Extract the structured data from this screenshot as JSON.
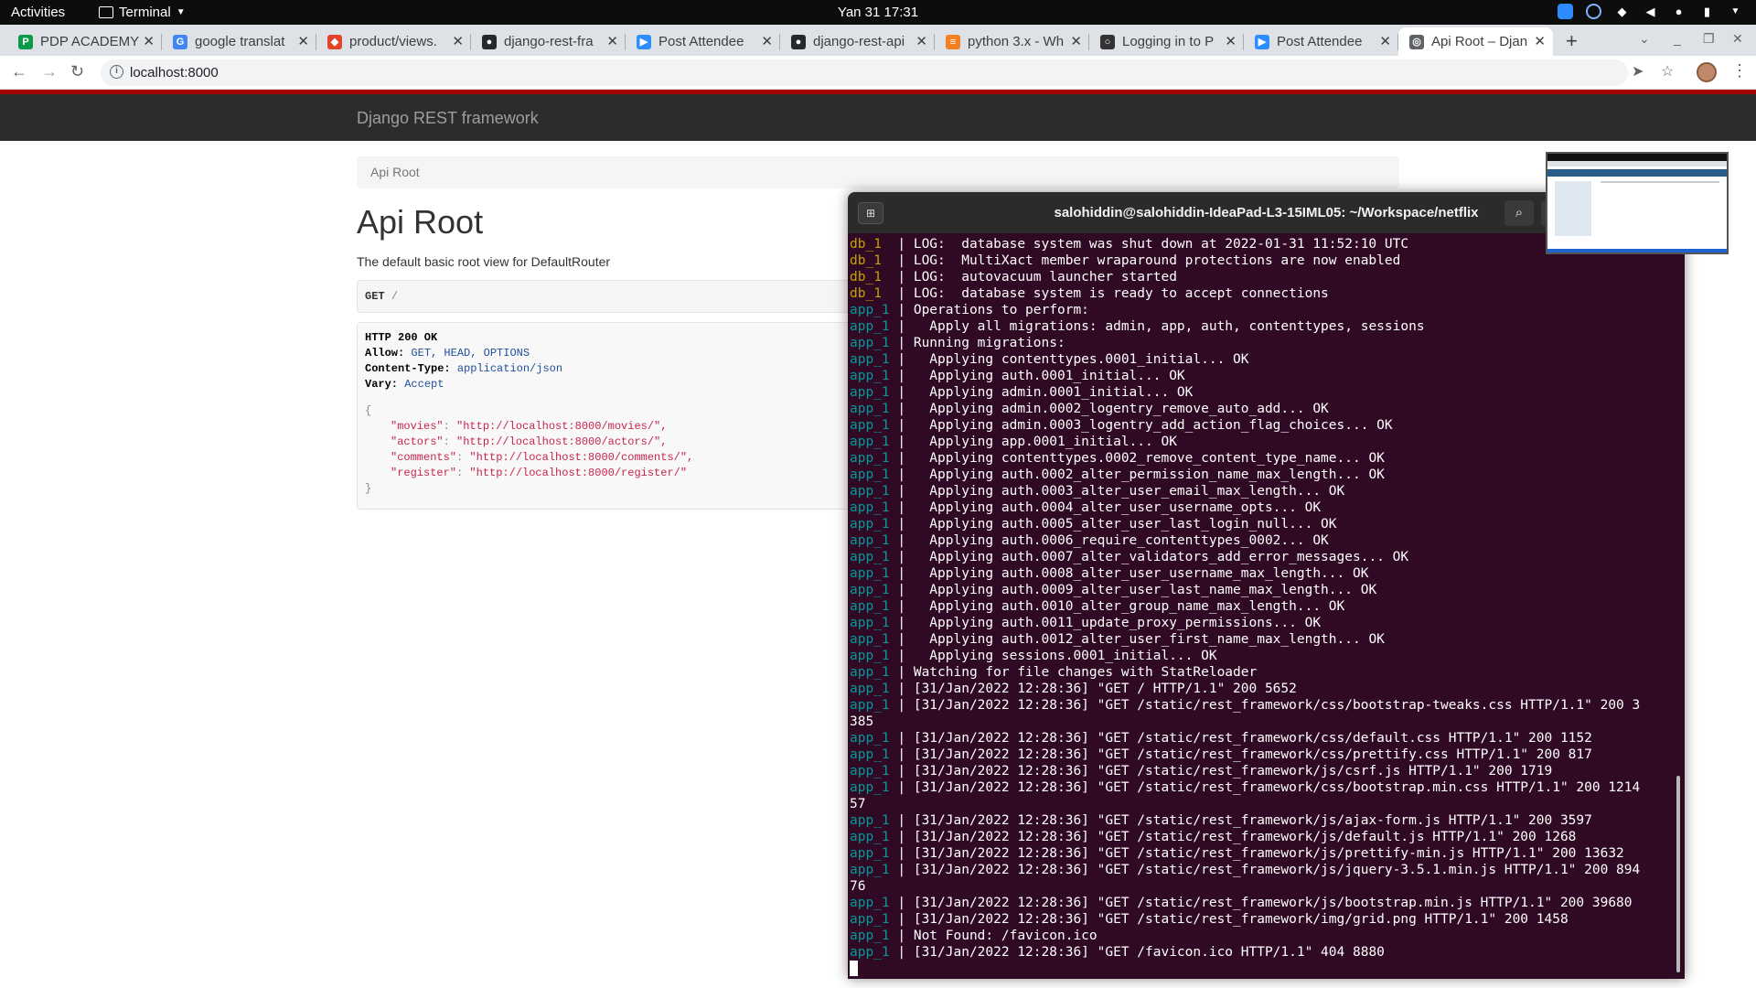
{
  "topbar": {
    "activities": "Activities",
    "app_name": "Terminal",
    "clock": "Yan 31  17:31"
  },
  "browser": {
    "tabs": [
      {
        "title": "PDP ACADEMY",
        "icon": "pdp-icon",
        "color": "#0a9a4a"
      },
      {
        "title": "google translat",
        "icon": "google-icon",
        "color": "#4285f4"
      },
      {
        "title": "product/views.",
        "icon": "gitlab-icon",
        "color": "#e24329"
      },
      {
        "title": "django-rest-fra",
        "icon": "github-icon",
        "color": "#24292e"
      },
      {
        "title": "Post Attendee",
        "icon": "zoom-icon",
        "color": "#2d8cff"
      },
      {
        "title": "django-rest-api",
        "icon": "github-icon",
        "color": "#24292e"
      },
      {
        "title": "python 3.x - Wh",
        "icon": "stackoverflow-icon",
        "color": "#f48024"
      },
      {
        "title": "Logging in to P",
        "icon": "circle-icon",
        "color": "#333333"
      },
      {
        "title": "Post Attendee",
        "icon": "zoom-icon",
        "color": "#2d8cff"
      },
      {
        "title": "Api Root – Djan",
        "icon": "globe-icon",
        "color": "#5f6368"
      }
    ],
    "url": "localhost:8000"
  },
  "drf": {
    "brand": "Django REST framework",
    "breadcrumb": "Api Root",
    "title": "Api Root",
    "description": "The default basic root view for DefaultRouter",
    "request_method": "GET",
    "request_path": "/",
    "response_status": "HTTP 200 OK",
    "headers": [
      {
        "key": "Allow:",
        "value": "GET, HEAD, OPTIONS"
      },
      {
        "key": "Content-Type:",
        "value": "application/json"
      },
      {
        "key": "Vary:",
        "value": "Accept"
      }
    ],
    "json_open": "{",
    "json_close": "}",
    "json_entries": [
      {
        "key": "\"movies\"",
        "value": "\"http://localhost:8000/movies/\","
      },
      {
        "key": "\"actors\"",
        "value": "\"http://localhost:8000/actors/\","
      },
      {
        "key": "\"comments\"",
        "value": "\"http://localhost:8000/comments/\","
      },
      {
        "key": "\"register\"",
        "value": "\"http://localhost:8000/register/\""
      }
    ]
  },
  "terminal": {
    "title": "salohiddin@salohiddin-IdeaPad-L3-15IML05: ~/Workspace/netflix",
    "lines": [
      {
        "svc": "db_1",
        "text": "  | LOG:  database system was shut down at 2022-01-31 11:52:10 UTC"
      },
      {
        "svc": "db_1",
        "text": "  | LOG:  MultiXact member wraparound protections are now enabled"
      },
      {
        "svc": "db_1",
        "text": "  | LOG:  autovacuum launcher started"
      },
      {
        "svc": "db_1",
        "text": "  | LOG:  database system is ready to accept connections"
      },
      {
        "svc": "app_1",
        "text": " | Operations to perform:"
      },
      {
        "svc": "app_1",
        "text": " |   Apply all migrations: admin, app, auth, contenttypes, sessions"
      },
      {
        "svc": "app_1",
        "text": " | Running migrations:"
      },
      {
        "svc": "app_1",
        "text": " |   Applying contenttypes.0001_initial... OK"
      },
      {
        "svc": "app_1",
        "text": " |   Applying auth.0001_initial... OK"
      },
      {
        "svc": "app_1",
        "text": " |   Applying admin.0001_initial... OK"
      },
      {
        "svc": "app_1",
        "text": " |   Applying admin.0002_logentry_remove_auto_add... OK"
      },
      {
        "svc": "app_1",
        "text": " |   Applying admin.0003_logentry_add_action_flag_choices... OK"
      },
      {
        "svc": "app_1",
        "text": " |   Applying app.0001_initial... OK"
      },
      {
        "svc": "app_1",
        "text": " |   Applying contenttypes.0002_remove_content_type_name... OK"
      },
      {
        "svc": "app_1",
        "text": " |   Applying auth.0002_alter_permission_name_max_length... OK"
      },
      {
        "svc": "app_1",
        "text": " |   Applying auth.0003_alter_user_email_max_length... OK"
      },
      {
        "svc": "app_1",
        "text": " |   Applying auth.0004_alter_user_username_opts... OK"
      },
      {
        "svc": "app_1",
        "text": " |   Applying auth.0005_alter_user_last_login_null... OK"
      },
      {
        "svc": "app_1",
        "text": " |   Applying auth.0006_require_contenttypes_0002... OK"
      },
      {
        "svc": "app_1",
        "text": " |   Applying auth.0007_alter_validators_add_error_messages... OK"
      },
      {
        "svc": "app_1",
        "text": " |   Applying auth.0008_alter_user_username_max_length... OK"
      },
      {
        "svc": "app_1",
        "text": " |   Applying auth.0009_alter_user_last_name_max_length... OK"
      },
      {
        "svc": "app_1",
        "text": " |   Applying auth.0010_alter_group_name_max_length... OK"
      },
      {
        "svc": "app_1",
        "text": " |   Applying auth.0011_update_proxy_permissions... OK"
      },
      {
        "svc": "app_1",
        "text": " |   Applying auth.0012_alter_user_first_name_max_length... OK"
      },
      {
        "svc": "app_1",
        "text": " |   Applying sessions.0001_initial... OK"
      },
      {
        "svc": "app_1",
        "text": " | Watching for file changes with StatReloader"
      },
      {
        "svc": "app_1",
        "text": " | [31/Jan/2022 12:28:36] \"GET / HTTP/1.1\" 200 5652"
      },
      {
        "svc": "app_1",
        "text": " | [31/Jan/2022 12:28:36] \"GET /static/rest_framework/css/bootstrap-tweaks.css HTTP/1.1\" 200 3"
      },
      {
        "svc": "",
        "text": "385"
      },
      {
        "svc": "app_1",
        "text": " | [31/Jan/2022 12:28:36] \"GET /static/rest_framework/css/default.css HTTP/1.1\" 200 1152"
      },
      {
        "svc": "app_1",
        "text": " | [31/Jan/2022 12:28:36] \"GET /static/rest_framework/css/prettify.css HTTP/1.1\" 200 817"
      },
      {
        "svc": "app_1",
        "text": " | [31/Jan/2022 12:28:36] \"GET /static/rest_framework/js/csrf.js HTTP/1.1\" 200 1719"
      },
      {
        "svc": "app_1",
        "text": " | [31/Jan/2022 12:28:36] \"GET /static/rest_framework/css/bootstrap.min.css HTTP/1.1\" 200 1214"
      },
      {
        "svc": "",
        "text": "57"
      },
      {
        "svc": "app_1",
        "text": " | [31/Jan/2022 12:28:36] \"GET /static/rest_framework/js/ajax-form.js HTTP/1.1\" 200 3597"
      },
      {
        "svc": "app_1",
        "text": " | [31/Jan/2022 12:28:36] \"GET /static/rest_framework/js/default.js HTTP/1.1\" 200 1268"
      },
      {
        "svc": "app_1",
        "text": " | [31/Jan/2022 12:28:36] \"GET /static/rest_framework/js/prettify-min.js HTTP/1.1\" 200 13632"
      },
      {
        "svc": "app_1",
        "text": " | [31/Jan/2022 12:28:36] \"GET /static/rest_framework/js/jquery-3.5.1.min.js HTTP/1.1\" 200 894"
      },
      {
        "svc": "",
        "text": "76"
      },
      {
        "svc": "app_1",
        "text": " | [31/Jan/2022 12:28:36] \"GET /static/rest_framework/js/bootstrap.min.js HTTP/1.1\" 200 39680"
      },
      {
        "svc": "app_1",
        "text": " | [31/Jan/2022 12:28:36] \"GET /static/rest_framework/img/grid.png HTTP/1.1\" 200 1458"
      },
      {
        "svc": "app_1",
        "text": " | Not Found: /favicon.ico"
      },
      {
        "svc": "app_1",
        "text": " | [31/Jan/2022 12:28:36] \"GET /favicon.ico HTTP/1.1\" 404 8880"
      }
    ]
  },
  "colors": {
    "terminal_bg": "#300a24",
    "db_service": "#c4a000",
    "app_service": "#06989a",
    "drf_navbar": "#2c2c2c",
    "drf_accent": "#a30000"
  }
}
